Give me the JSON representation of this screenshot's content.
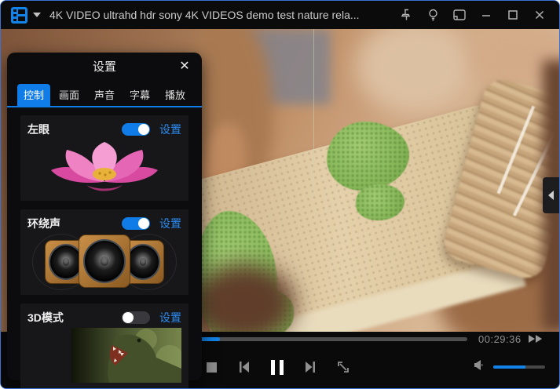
{
  "titlebar": {
    "title": "4K VIDEO ultrahd hdr sony 4K VIDEOS demo test nature rela...",
    "app_icon": "film-strip-icon",
    "menu_caret": "dropdown-caret-icon",
    "window_icons": [
      "pin-icon",
      "lightbulb-icon",
      "mini-window-icon",
      "minimize-icon",
      "maximize-icon",
      "close-icon"
    ]
  },
  "settings_panel": {
    "title": "设置",
    "close_label": "✕",
    "tabs": [
      {
        "label": "控制",
        "active": true
      },
      {
        "label": "画面",
        "active": false
      },
      {
        "label": "声音",
        "active": false
      },
      {
        "label": "字幕",
        "active": false
      },
      {
        "label": "播放",
        "active": false
      }
    ],
    "sections": [
      {
        "label": "左眼",
        "toggle_on": true,
        "action_label": "设置",
        "image": "lotus-flower"
      },
      {
        "label": "环绕声",
        "toggle_on": true,
        "action_label": "设置",
        "image": "triple-speakers"
      },
      {
        "label": "3D模式",
        "toggle_on": false,
        "action_label": "设置",
        "image": "dinosaur"
      }
    ]
  },
  "player": {
    "elapsed_time": "00:29:36",
    "progress_percent": 46,
    "volume_percent": 62,
    "controls": [
      "stop",
      "previous",
      "pause",
      "next",
      "fullscreen",
      "fast-forward",
      "volume"
    ]
  },
  "flyout": {
    "icon": "chevron-left-icon"
  },
  "colors": {
    "accent": "#1283e8",
    "link_blue": "#2a8cf0",
    "tab_active": "#0f7ce8",
    "time_text": "#8f8f8f",
    "track_gray": "#4e4e4e"
  }
}
